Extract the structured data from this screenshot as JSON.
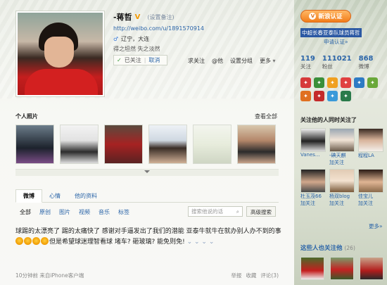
{
  "profile": {
    "name": "-蒋哲",
    "verified_mark": "V",
    "remark_label": "(设置备注)",
    "url": "http://weibo.com/u/1891570914",
    "location": "辽宁，大连",
    "signature": "得之坦然 失之淡然",
    "follow_status": "已关注",
    "cancel_label": "取消",
    "actions": [
      "求关注",
      "@他",
      "设置分组",
      "更多"
    ]
  },
  "photos": {
    "title": "个人照片",
    "view_all": "查看全部",
    "items": [
      "photo-1",
      "photo-2",
      "photo-3",
      "photo-4",
      "photo-5",
      "photo-6"
    ]
  },
  "tabs": [
    {
      "label": "微博",
      "active": true
    },
    {
      "label": "心情",
      "active": false
    },
    {
      "label": "他的资料",
      "active": false
    }
  ],
  "filters": [
    "全部",
    "原创",
    "图片",
    "视频",
    "音乐",
    "标签"
  ],
  "search": {
    "placeholder": "搜索他说的话"
  },
  "advanced_search": "高级搜索",
  "post": {
    "text_before": "球踢的太漂亮了 踢的太痛快了 感谢对手逼发出了我们的潜能 亚泰牛就牛在就办别人办不到的事",
    "text_after": "但是希望球迷理智看球 堵车? 砸玻璃? 能免则免!",
    "emoticon_count": 4,
    "meta_left": "10分钟前  来自iPhone客户端",
    "meta_right": [
      "举报",
      "收藏",
      "评论(3)"
    ]
  },
  "sidebar": {
    "verify_badge": "新浪认证",
    "cert_text": "中超长春亚泰队球员蒋哲",
    "apply_label": "申请认证»",
    "stats": [
      {
        "n": "119",
        "l": "关注"
      },
      {
        "n": "111021",
        "l": "粉丝"
      },
      {
        "n": "868",
        "l": "微博"
      }
    ],
    "icon_colors": [
      "#d63a3a",
      "#3a8f3a",
      "#f0a020",
      "#e04040",
      "#2e7bc4",
      "#6aa83a",
      "#e07020",
      "#c42a2a",
      "#3a9ad9",
      "#2a7a4a"
    ],
    "mutual_title": "关注他的人同时关注了",
    "mutual_people": [
      {
        "name": "Vanes...",
        "add": ""
      },
      {
        "name": "-碘天麒",
        "add": "加关注"
      },
      {
        "name": "程程LA",
        "add": ""
      },
      {
        "name": "杜玉茂66",
        "add": "加关注"
      },
      {
        "name": "杨双blog",
        "add": "加关注"
      },
      {
        "name": "佳宝儿",
        "add": "加关注"
      }
    ],
    "more_label": "更多»",
    "also_title": "这些人也关注他",
    "also_count": "(26)"
  }
}
